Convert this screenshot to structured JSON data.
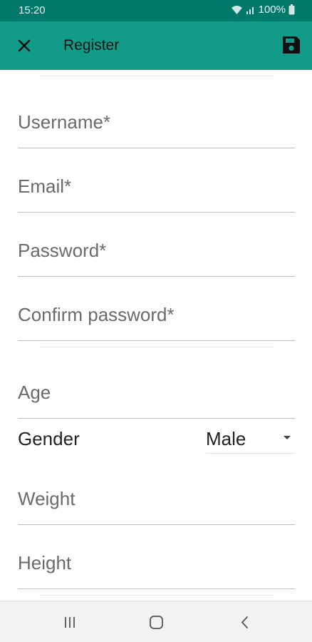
{
  "status_bar": {
    "time": "15:20",
    "battery_text": "100%",
    "icons": [
      "wifi-icon",
      "signal-icon",
      "battery-icon"
    ]
  },
  "app_bar": {
    "title": "Register",
    "close_icon": "close-icon",
    "save_icon": "save-icon",
    "color": "#139b8a"
  },
  "form": {
    "username_placeholder": "Username*",
    "email_placeholder": "Email*",
    "password_placeholder": "Password*",
    "confirm_password_placeholder": "Confirm password*",
    "age_placeholder": "Age",
    "gender_label": "Gender",
    "gender_value": "Male",
    "weight_placeholder": "Weight",
    "height_placeholder": "Height"
  },
  "nav_bar": {
    "icons": [
      "recent-apps-icon",
      "home-icon",
      "back-icon"
    ]
  }
}
